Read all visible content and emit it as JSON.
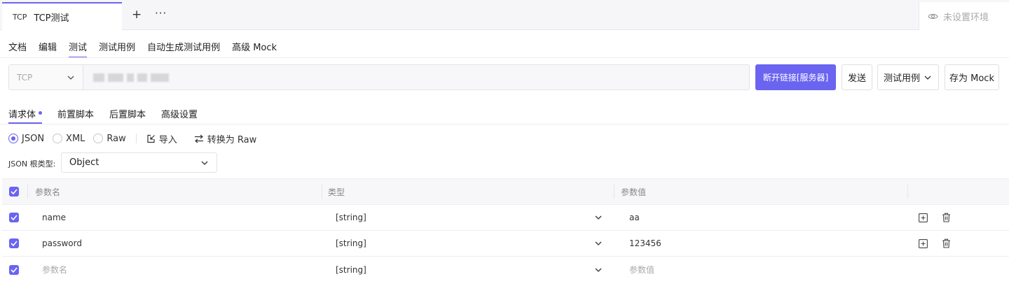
{
  "tab": {
    "protocol": "TCP",
    "name": "TCP测试",
    "add": "+",
    "more": "···"
  },
  "environment": {
    "label": "未设置环境"
  },
  "subnav": [
    {
      "label": "文档"
    },
    {
      "label": "编辑"
    },
    {
      "label": "测试",
      "active": true
    },
    {
      "label": "测试用例"
    },
    {
      "label": "自动生成测试用例"
    },
    {
      "label": "高级 Mock"
    }
  ],
  "request": {
    "method": "TCP",
    "url_hidden": true,
    "connect_button": "断开链接[服务器]",
    "send_button": "发送",
    "testcase_button": "测试用例",
    "mock_button": "存为 Mock"
  },
  "body_tabs": [
    {
      "label": "请求体",
      "active": true,
      "has_dot": true
    },
    {
      "label": "前置脚本"
    },
    {
      "label": "后置脚本"
    },
    {
      "label": "高级设置"
    }
  ],
  "formats": [
    {
      "label": "JSON",
      "selected": true
    },
    {
      "label": "XML",
      "selected": false
    },
    {
      "label": "Raw",
      "selected": false
    }
  ],
  "tools": {
    "import": "导入",
    "convert": "转换为 Raw"
  },
  "root_type": {
    "label": "JSON 根类型:",
    "value": "Object"
  },
  "table": {
    "headers": {
      "name": "参数名",
      "type": "类型",
      "value": "参数值"
    },
    "rows": [
      {
        "checked": true,
        "name": "name",
        "type": "[string]",
        "value": "aa"
      },
      {
        "checked": true,
        "name": "password",
        "type": "[string]",
        "value": "123456"
      }
    ],
    "placeholder_row": {
      "checked": true,
      "name_placeholder": "参数名",
      "type": "[string]",
      "value_placeholder": "参数值"
    }
  },
  "colors": {
    "accent": "#6a64f1",
    "border": "#e3e3e8"
  },
  "icons": [
    "plus-icon",
    "more-icon",
    "eye-icon",
    "chevron-down-icon",
    "import-icon",
    "convert-icon",
    "check-icon",
    "add-row-icon",
    "trash-icon"
  ]
}
